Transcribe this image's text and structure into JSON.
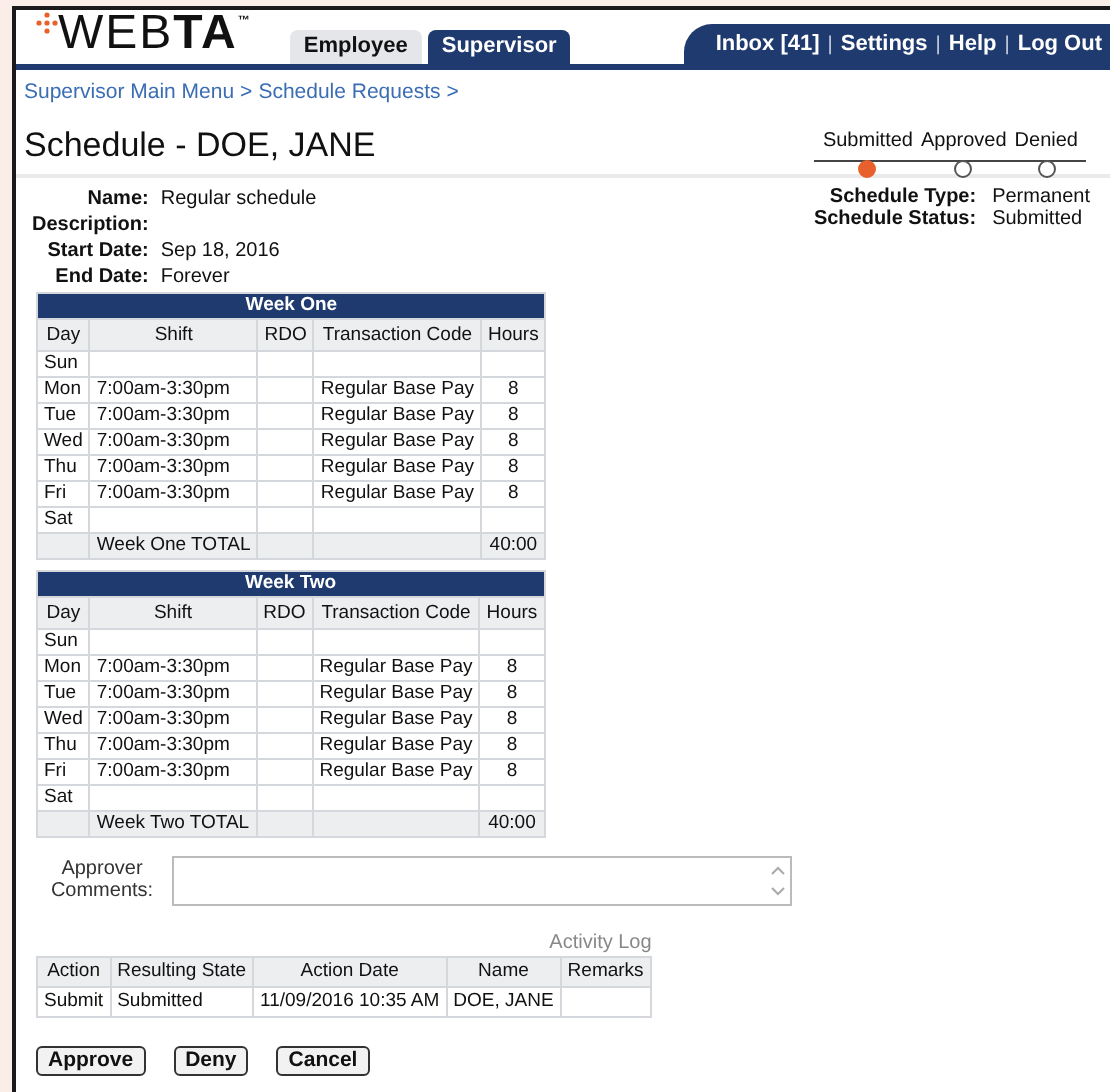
{
  "header": {
    "logo": "WEBTA",
    "logo_mark": "™",
    "tabs": [
      {
        "label": "Employee",
        "selected": false
      },
      {
        "label": "Supervisor",
        "selected": true
      }
    ],
    "links": [
      {
        "label": "Inbox [41]"
      },
      {
        "separator": "|",
        "label": "Settings"
      },
      {
        "separator": "|",
        "label": "Help"
      },
      {
        "separator": "|",
        "label": "Log Out"
      }
    ]
  },
  "breadcrumb": [
    {
      "label": "Supervisor Main Menu",
      "separator": ">"
    },
    {
      "label": "Schedule Requests",
      "separator": ">"
    }
  ],
  "title": "Schedule - DOE, JANE",
  "steps": [
    {
      "label": "Submitted",
      "selected": true
    },
    {
      "label": "Approved",
      "selected": false
    },
    {
      "label": "Denied",
      "selected": false
    }
  ],
  "details": [
    {
      "label": "Name:",
      "value": "Regular schedule"
    },
    {
      "label": "Description:"
    },
    {
      "label": "Start Date:",
      "value": "Sep 18, 2016"
    },
    {
      "label": "End Date:",
      "value": "Forever"
    }
  ],
  "summary": [
    {
      "label": "Schedule Type:",
      "value": "Permanent"
    },
    {
      "label": "Schedule Status:",
      "value": "Submitted"
    }
  ],
  "weeks": [
    {
      "title": "Week One",
      "columns": [
        "Day",
        "Shift",
        "RDO",
        "Transaction Code",
        "Hours"
      ],
      "rows": [
        [
          "Sun",
          null,
          null,
          null,
          null
        ],
        [
          "Mon",
          "7:00am-3:30pm",
          null,
          "Regular Base Pay",
          "8"
        ],
        [
          "Tue",
          "7:00am-3:30pm",
          null,
          "Regular Base Pay",
          "8"
        ],
        [
          "Wed",
          "7:00am-3:30pm",
          null,
          "Regular Base Pay",
          "8"
        ],
        [
          "Thu",
          "7:00am-3:30pm",
          null,
          "Regular Base Pay",
          "8"
        ],
        [
          "Fri",
          "7:00am-3:30pm",
          null,
          "Regular Base Pay",
          "8"
        ],
        [
          "Sat",
          null,
          null,
          null,
          null
        ]
      ],
      "total": {
        "label": "Week One TOTAL",
        "hours": "40:00"
      }
    },
    {
      "title": "Week Two",
      "columns": [
        "Day",
        "Shift",
        "RDO",
        "Transaction Code",
        "Hours"
      ],
      "rows": [
        [
          "Sun",
          null,
          null,
          null,
          null
        ],
        [
          "Mon",
          "7:00am-3:30pm",
          null,
          "Regular Base Pay",
          "8"
        ],
        [
          "Tue",
          "7:00am-3:30pm",
          null,
          "Regular Base Pay",
          "8"
        ],
        [
          "Wed",
          "7:00am-3:30pm",
          null,
          "Regular Base Pay",
          "8"
        ],
        [
          "Thu",
          "7:00am-3:30pm",
          null,
          "Regular Base Pay",
          "8"
        ],
        [
          "Fri",
          "7:00am-3:30pm",
          null,
          "Regular Base Pay",
          "8"
        ],
        [
          "Sat",
          null,
          null,
          null,
          null
        ]
      ],
      "total": {
        "label": "Week Two TOTAL",
        "hours": "40:00"
      }
    }
  ],
  "comments": {
    "label": "Approver Comments:"
  },
  "activity_log": {
    "title": "Activity Log",
    "columns": [
      "Action",
      "Resulting State",
      "Action Date",
      "Name",
      "Remarks"
    ],
    "rows": [
      [
        "Submit",
        "Submitted",
        "11/09/2016 10:35 AM",
        "DOE, JANE",
        null
      ]
    ]
  },
  "buttons": [
    "Approve",
    "Deny",
    "Cancel"
  ]
}
